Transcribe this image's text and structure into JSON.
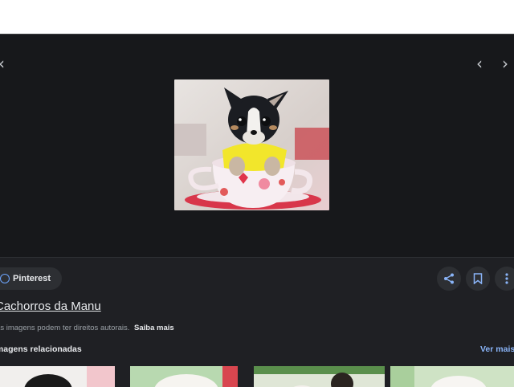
{
  "viewer": {
    "nav_left_icon": "chevron-left-icon",
    "prev_icon": "chevron-left-icon",
    "next_icon": "chevron-right-icon"
  },
  "details": {
    "source": "Pinterest",
    "title": "Cachorros da Manu",
    "copyright": "As imagens podem ter direitos autorais.",
    "learn_more": "Saiba mais"
  },
  "related": {
    "title": "Imagens relacionadas",
    "see_more": "Ver mais"
  },
  "colors": {
    "panel_bg": "#1f2024",
    "viewer_bg": "#17181b",
    "accent": "#8ab4f8",
    "text": "#e8eaed",
    "muted": "#9aa0a6"
  }
}
